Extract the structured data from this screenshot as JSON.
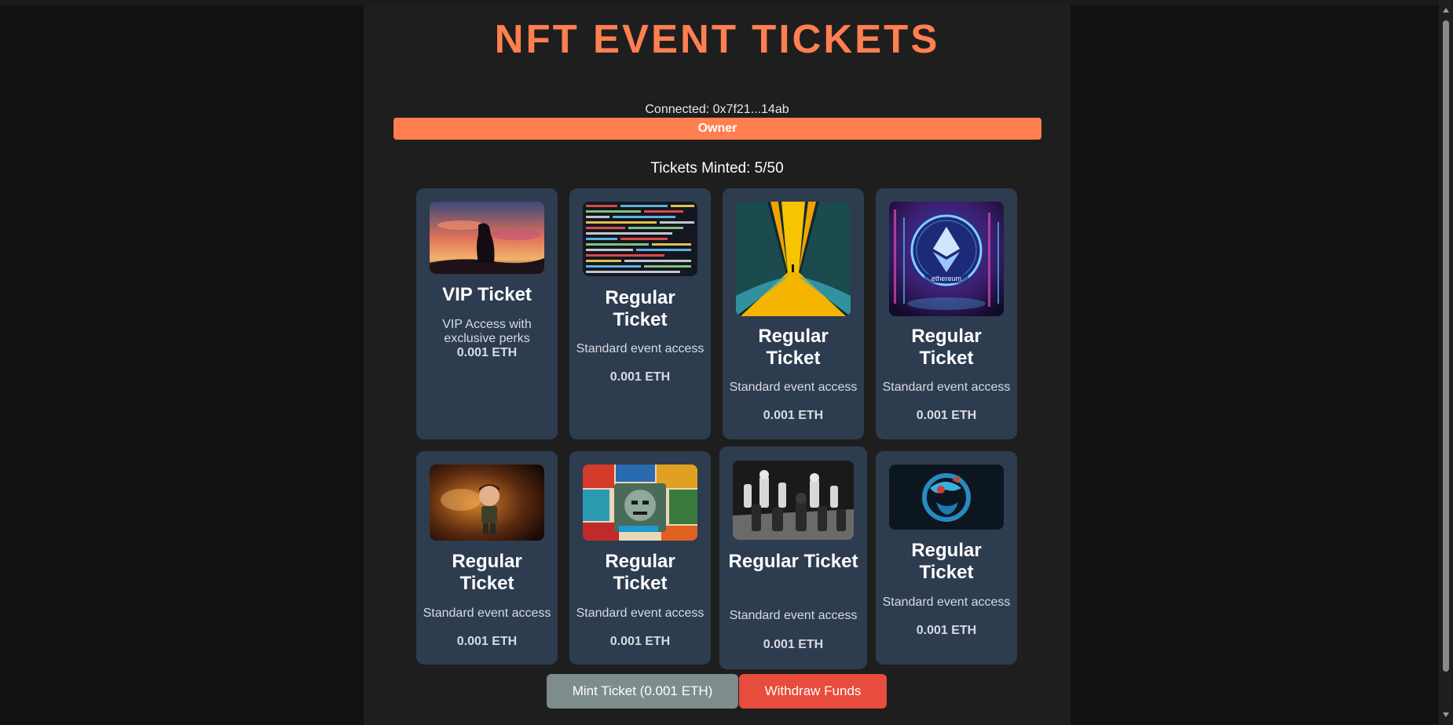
{
  "header": {
    "title": "NFT EVENT TICKETS"
  },
  "account": {
    "connected_text": "Connected: 0x7f21...14ab",
    "role": "Owner"
  },
  "stats": {
    "minted_text": "Tickets Minted: 5/50"
  },
  "tickets": [
    {
      "title": "VIP Ticket",
      "description": "VIP Access with exclusive perks",
      "price": "0.001 ETH",
      "image": "sunset-silhouette"
    },
    {
      "title": "Regular Ticket",
      "description": "Standard event access",
      "price": "0.001 ETH",
      "image": "code-screen"
    },
    {
      "title": "Regular Ticket",
      "description": "Standard event access",
      "price": "0.001 ETH",
      "image": "yellow-tunnel"
    },
    {
      "title": "Regular Ticket",
      "description": "Standard event access",
      "price": "0.001 ETH",
      "image": "ethereum-coin"
    },
    {
      "title": "Regular Ticket",
      "description": "Standard event access",
      "price": "0.001 ETH",
      "image": "toy-figure"
    },
    {
      "title": "Regular Ticket",
      "description": "Standard event access",
      "price": "0.001 ETH",
      "image": "comic-collage"
    },
    {
      "title": "Regular Ticket",
      "description": "Standard event access",
      "price": "0.001 ETH",
      "image": "chess-pieces"
    },
    {
      "title": "Regular Ticket",
      "description": "Standard event access",
      "price": "0.001 ETH",
      "image": "blue-dragon"
    }
  ],
  "ethereum_image_text": "ethereum",
  "actions": {
    "mint_label": "Mint Ticket (0.001 ETH)",
    "withdraw_label": "Withdraw Funds"
  },
  "colors": {
    "accent": "#ff7f50",
    "card": "#2e3c50",
    "mint": "#7f8c8d",
    "withdraw": "#e74c3c"
  }
}
